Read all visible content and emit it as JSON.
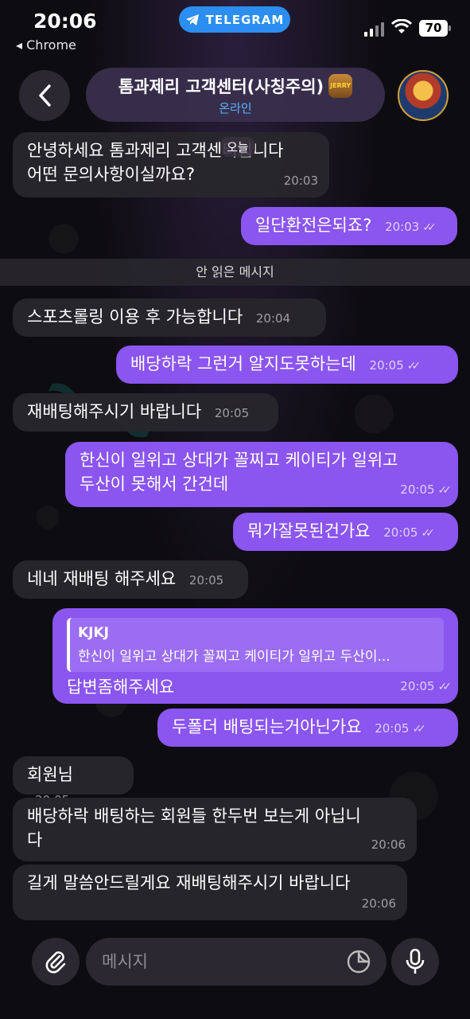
{
  "status_bar": {
    "time": "20:06",
    "back_app": "Chrome",
    "app_pill": "TELEGRAM",
    "battery": "70"
  },
  "header": {
    "title": "톰과제리 고객센터(사칭주의)",
    "badge_text": "JERRY",
    "subtitle": "온라인"
  },
  "date_float": "오늘",
  "unread_label": "안 읽은 메시지",
  "messages": [
    {
      "dir": "in",
      "text_l1": "안녕하세요 톰과제리 고객센터입니다",
      "text_l2": "어떤 문의사항이실까요?",
      "time": "20:03"
    },
    {
      "dir": "out",
      "text": "일단환전은되죠?",
      "time": "20:03"
    },
    {
      "dir": "in",
      "text": "스포츠롤링 이용 후 가능합니다",
      "time": "20:04"
    },
    {
      "dir": "out",
      "text": "배당하락 그런거 알지도못하는데",
      "time": "20:05"
    },
    {
      "dir": "in",
      "text": "재배팅해주시기 바랍니다",
      "time": "20:05"
    },
    {
      "dir": "out",
      "text_l1": "한신이 일위고 상대가 꼴찌고 케이티가 일위고",
      "text_l2": "두산이 못해서 간건데",
      "time": "20:05"
    },
    {
      "dir": "out",
      "text": "뭐가잘못된건가요",
      "time": "20:05"
    },
    {
      "dir": "in",
      "text": "네네 재배팅 해주세요",
      "time": "20:05"
    },
    {
      "dir": "out",
      "reply_name": "KJKJ",
      "reply_text": "한신이 일위고 상대가 꼴찌고 케이티가 일위고 두산이...",
      "text": "답변좀해주세요",
      "time": "20:05"
    },
    {
      "dir": "out",
      "text": "두폴더 배팅되는거아닌가요",
      "time": "20:05"
    },
    {
      "dir": "in",
      "text": "회원님",
      "time": "20:05"
    },
    {
      "dir": "in",
      "text_l1": "배당하락 배팅하는 회원들 한두번 보는게 아닙니",
      "text_l2": "다",
      "time": "20:06"
    },
    {
      "dir": "in",
      "text": "길게 말씀안드릴게요 재배팅해주시기 바랍니다",
      "time": "20:06"
    }
  ],
  "input": {
    "placeholder": "메시지"
  },
  "colors": {
    "outgoing_bubble": "#8b55f0",
    "incoming_bubble": "#28262c",
    "accent_blue": "#2b8ef0",
    "online_text": "#5ab3ff"
  },
  "icons": [
    "telegram-icon",
    "back-chevron-icon",
    "attach-paperclip-icon",
    "sticker-icon",
    "microphone-icon",
    "read-checks-icon"
  ]
}
